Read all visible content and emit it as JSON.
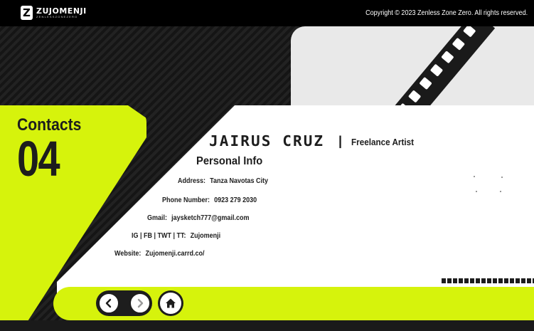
{
  "header": {
    "logo_name": "ZUJOMENJI",
    "logo_sub": "ZENLESSZONEZERO",
    "copyright": "Copyright © 2023 Zenless Zone Zero. All rights reserved."
  },
  "contacts": {
    "title": "Contacts",
    "number": "04"
  },
  "profile": {
    "name": "JAIRUS CRUZ",
    "divider": "|",
    "role": "Freelance Artist",
    "section_title": "Personal Info",
    "fields": [
      {
        "label": "Address:",
        "value": "Tanza Navotas City"
      },
      {
        "label": "Phone Number:",
        "value": "0923 279 2030"
      },
      {
        "label": "Gmail:",
        "value": "jaysketch777@gmail.com"
      },
      {
        "label": "IG | FB | TWT | TT:",
        "value": "Zujomenji"
      },
      {
        "label": "Website:",
        "value": "Zujomenji.carrd.co/"
      }
    ]
  },
  "nav": {
    "icons": [
      "chevron-left-icon",
      "chevron-right-icon",
      "home-icon"
    ]
  },
  "colors": {
    "accent": "#d6f30c",
    "dark": "#1d1d1d",
    "card": "#ffffff"
  }
}
